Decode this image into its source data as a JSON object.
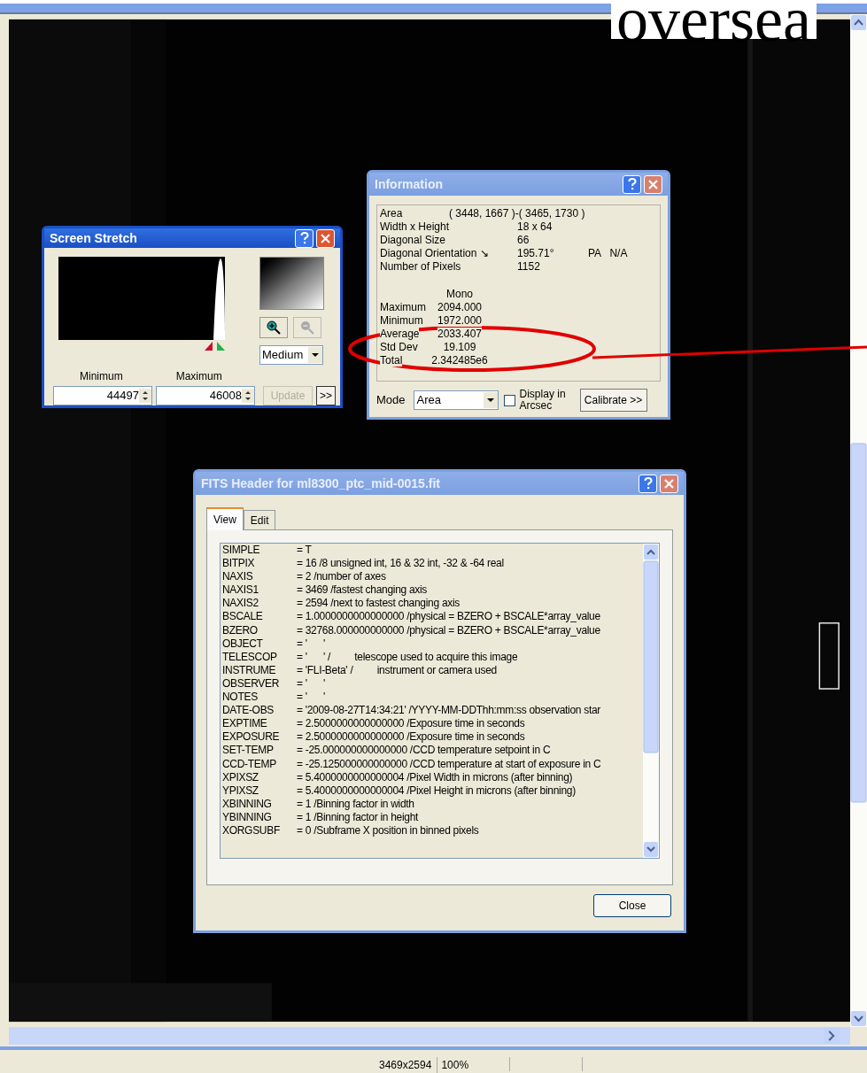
{
  "overlay_text": "oversea",
  "screen_stretch": {
    "title": "Screen Stretch",
    "minimum_label": "Minimum",
    "maximum_label": "Maximum",
    "minimum": "44497",
    "maximum": "46008",
    "preset": "Medium",
    "update": "Update",
    "expand": ">>",
    "update_disabled": true
  },
  "information": {
    "title": "Information",
    "rows": [
      {
        "label": "Area",
        "value": "( 3448, 1667 )-( 3465, 1730 )",
        "kind": "wide"
      },
      {
        "label": "Width x Height",
        "value": "18 x 64",
        "kind": "normal"
      },
      {
        "label": "Diagonal Size",
        "value": "66",
        "kind": "normal"
      },
      {
        "label": "Diagonal Orientation ↘",
        "value": "195.71°",
        "extra": "PA   N/A",
        "kind": "normal"
      },
      {
        "label": "Number of Pixels",
        "value": "1152",
        "kind": "normal"
      }
    ],
    "stats_heading": "Mono",
    "stats": [
      {
        "label": "Maximum",
        "value": "2094.000"
      },
      {
        "label": "Minimum",
        "value": "1972.000"
      },
      {
        "label": "Average",
        "value": "2033.407"
      },
      {
        "label": "Std Dev",
        "value": "19.109"
      },
      {
        "label": "Total",
        "value": "2.342485e6"
      }
    ],
    "mode_label": "Mode",
    "mode": "Area",
    "arcsec_label": "Display in Arcsec",
    "arcsec_checked": false,
    "calibrate": "Calibrate >>"
  },
  "fits_header": {
    "title": "FITS Header for ml8300_ptc_mid-0015.fit",
    "tabs": [
      {
        "label": "View",
        "selected": true
      },
      {
        "label": "Edit",
        "selected": false
      }
    ],
    "rows": [
      {
        "key": "SIMPLE",
        "value": "= T"
      },
      {
        "key": "BITPIX",
        "value": "= 16 /8 unsigned int, 16 & 32 int, -32 & -64 real"
      },
      {
        "key": "NAXIS",
        "value": "= 2 /number of axes"
      },
      {
        "key": "NAXIS1",
        "value": "= 3469 /fastest changing axis"
      },
      {
        "key": "NAXIS2",
        "value": "= 2594 /next to fastest changing axis"
      },
      {
        "key": "BSCALE",
        "value": "= 1.0000000000000000 /physical = BZERO + BSCALE*array_value"
      },
      {
        "key": "BZERO",
        "value": "= 32768.000000000000 /physical = BZERO + BSCALE*array_value"
      },
      {
        "key": "OBJECT",
        "value": "= '      '"
      },
      {
        "key": "TELESCOP",
        "value": "= '      ' /         telescope used to acquire this image"
      },
      {
        "key": "INSTRUME",
        "value": "= 'FLI-Beta' /         instrument or camera used"
      },
      {
        "key": "OBSERVER",
        "value": "= '      '"
      },
      {
        "key": "NOTES",
        "value": "= '      '"
      },
      {
        "key": "DATE-OBS",
        "value": "= '2009-08-27T14:34:21' /YYYY-MM-DDThh:mm:ss observation star"
      },
      {
        "key": "EXPTIME",
        "value": "= 2.5000000000000000 /Exposure time in seconds"
      },
      {
        "key": "EXPOSURE",
        "value": "= 2.5000000000000000 /Exposure time in seconds"
      },
      {
        "key": "SET-TEMP",
        "value": "= -25.000000000000000 /CCD temperature setpoint in C"
      },
      {
        "key": "CCD-TEMP",
        "value": "= -25.125000000000000 /CCD temperature at start of exposure in C"
      },
      {
        "key": "XPIXSZ",
        "value": "= 5.4000000000000004 /Pixel Width in microns (after binning)"
      },
      {
        "key": "YPIXSZ",
        "value": "= 5.4000000000000004 /Pixel Height in microns (after binning)"
      },
      {
        "key": "XBINNING",
        "value": "= 1 /Binning factor in width"
      },
      {
        "key": "YBINNING",
        "value": "= 1 /Binning factor in height"
      },
      {
        "key": "XORGSUBF",
        "value": "= 0 /Subframe X position in binned pixels"
      }
    ],
    "close": "Close"
  },
  "status_bar": {
    "size": "3469x2594",
    "zoom": "100%"
  }
}
